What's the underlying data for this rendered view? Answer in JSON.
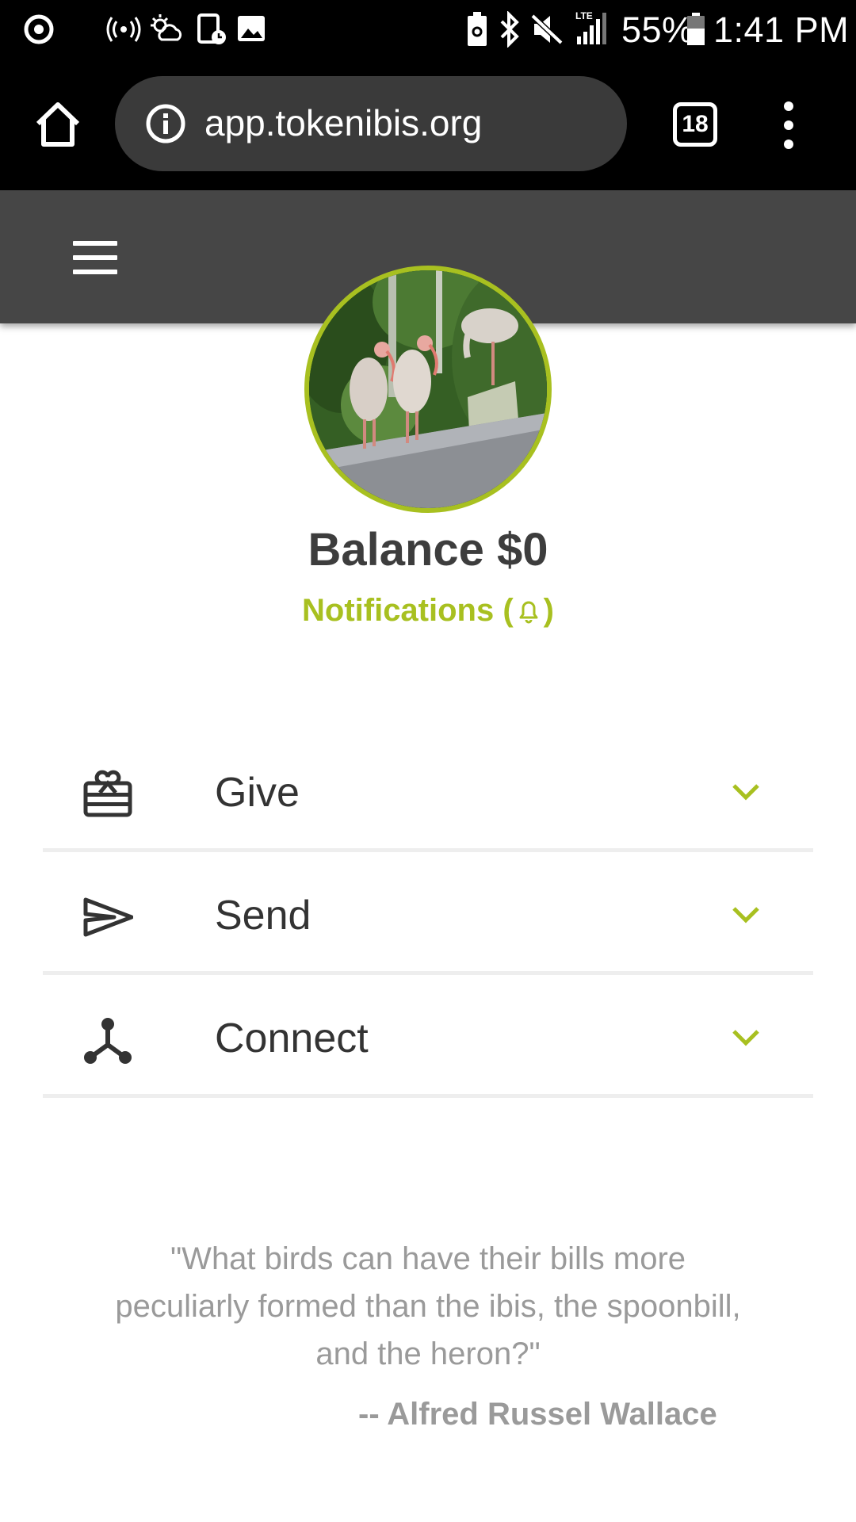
{
  "status_bar": {
    "battery_percent": "55%",
    "time": "1:41 PM",
    "icons": [
      "sync-icon",
      "hotspot-icon",
      "weather-icon",
      "screen-record-icon",
      "gallery-icon",
      "battery-saver-icon",
      "bluetooth-icon",
      "mute-icon",
      "lte-signal-icon",
      "battery-icon"
    ]
  },
  "browser": {
    "url": "app.tokenibis.org",
    "tab_count": "18",
    "icons": [
      "home-icon",
      "info-icon",
      "tabs-icon",
      "more-vert-icon"
    ]
  },
  "header": {
    "icon": "hamburger-menu-icon"
  },
  "profile": {
    "avatar": "ibis-photo",
    "balance": "Balance $0",
    "notifications_label": "Notifications (",
    "notifications_close": ")"
  },
  "actions": [
    {
      "label": "Give",
      "icon": "gift-card-icon"
    },
    {
      "label": "Send",
      "icon": "send-icon"
    },
    {
      "label": "Connect",
      "icon": "connect-icon"
    }
  ],
  "quote": {
    "text": "\"What birds can have their bills more peculiarly formed than the ibis, the spoonbill, and the heron?\"",
    "author": "-- Alfred Russel Wallace"
  },
  "colors": {
    "accent": "#a8c020",
    "header": "#464646",
    "text": "#333333",
    "muted": "#9a9a9a"
  }
}
